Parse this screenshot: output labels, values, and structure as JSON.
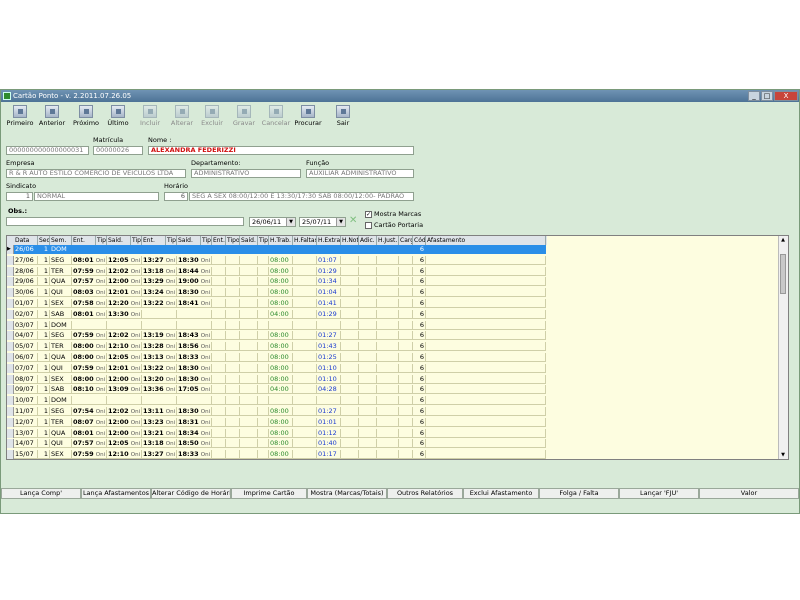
{
  "window": {
    "title": "Cartão Ponto - v. 2.2011.07.26.05",
    "minimize": "_",
    "maximize": "□",
    "close": "X"
  },
  "toolbar": [
    {
      "label": "Primeiro",
      "enabled": true
    },
    {
      "label": "Anterior",
      "enabled": true
    },
    {
      "label": "Próximo",
      "enabled": true
    },
    {
      "label": "Último",
      "enabled": true
    },
    {
      "label": "Incluir",
      "enabled": false
    },
    {
      "label": "Alterar",
      "enabled": false
    },
    {
      "label": "Excluir",
      "enabled": false
    },
    {
      "label": "Gravar",
      "enabled": false
    },
    {
      "label": "Cancelar",
      "enabled": false
    },
    {
      "label": "Procurar",
      "enabled": true
    },
    {
      "label": "Sair",
      "enabled": true
    }
  ],
  "form": {
    "matricula_label": "Matrícula",
    "nome_label": "Nome :",
    "code": "000000000000000031",
    "matricula": "00000026",
    "nome": "ALEXANDRA FEDERIZZI",
    "empresa_label": "Empresa",
    "empresa": "R & R AUTO ESTILO COMÉRCIO DE VEÍCULOS LTDA",
    "departamento_label": "Departamento:",
    "departamento": "ADMINISTRATIVO",
    "funcao_label": "Função",
    "funcao": "AUXILIAR ADMINISTRATIVO",
    "sindicato_label": "Sindicato",
    "sindicato_num": "1",
    "sindicato": "NORMAL",
    "horario_label": "Horário",
    "horario_num": "6",
    "horario": "SEG A SEX 08:00/12:00 E 13:30/17:30 SAB 08:00/12:00- PADRAO",
    "obs_label": "Obs.:",
    "date_from": "26/06/11",
    "date_to": "25/07/11",
    "mostra_marcas": "Mostra Marcas",
    "cartao_portaria": "Cartão Portaria"
  },
  "grid": {
    "headers": [
      "Data",
      "Seq.",
      "Sem.",
      "Ent.",
      "Tipo",
      "Saíd.",
      "Tipo",
      "Ent.",
      "Tipo",
      "Saíd.",
      "Tipo",
      "Ent.",
      "Tipo",
      "Saíd.",
      "Tipo",
      "H.Trab.",
      "H.Faltas",
      "H.Extras",
      "H.Not.",
      "Adic.",
      "H.Just.",
      "Carga",
      "Cód.",
      "Afastamento"
    ],
    "on_label": "Oni",
    "rows": [
      {
        "data": "26/06",
        "seq": "1",
        "sem": "DOM",
        "e1": "",
        "s1": "",
        "e2": "",
        "s2": "",
        "trab": "",
        "extra": "",
        "cod": "6",
        "selected": true
      },
      {
        "data": "27/06",
        "seq": "1",
        "sem": "SEG",
        "e1": "08:01",
        "s1": "12:05",
        "e2": "13:27",
        "s2": "18:30",
        "trab": "08:00",
        "extra": "01:07",
        "cod": "6"
      },
      {
        "data": "28/06",
        "seq": "1",
        "sem": "TER",
        "e1": "07:59",
        "s1": "12:02",
        "e2": "13:18",
        "s2": "18:44",
        "trab": "08:00",
        "extra": "01:29",
        "cod": "6"
      },
      {
        "data": "29/06",
        "seq": "1",
        "sem": "QUA",
        "e1": "07:57",
        "s1": "12:00",
        "e2": "13:29",
        "s2": "19:00",
        "trab": "08:00",
        "extra": "01:34",
        "cod": "6"
      },
      {
        "data": "30/06",
        "seq": "1",
        "sem": "QUI",
        "e1": "08:03",
        "s1": "12:01",
        "e2": "13:24",
        "s2": "18:30",
        "trab": "08:00",
        "extra": "01:04",
        "cod": "6"
      },
      {
        "data": "01/07",
        "seq": "1",
        "sem": "SEX",
        "e1": "07:58",
        "s1": "12:20",
        "e2": "13:22",
        "s2": "18:41",
        "trab": "08:00",
        "extra": "01:41",
        "cod": "6"
      },
      {
        "data": "02/07",
        "seq": "1",
        "sem": "SAB",
        "e1": "08:01",
        "s1": "13:30",
        "e2": "",
        "s2": "",
        "trab": "04:00",
        "extra": "01:29",
        "cod": "6"
      },
      {
        "data": "03/07",
        "seq": "1",
        "sem": "DOM",
        "e1": "",
        "s1": "",
        "e2": "",
        "s2": "",
        "trab": "",
        "extra": "",
        "cod": "6"
      },
      {
        "data": "04/07",
        "seq": "1",
        "sem": "SEG",
        "e1": "07:59",
        "s1": "12:02",
        "e2": "13:19",
        "s2": "18:43",
        "trab": "08:00",
        "extra": "01:27",
        "cod": "6"
      },
      {
        "data": "05/07",
        "seq": "1",
        "sem": "TER",
        "e1": "08:00",
        "s1": "12:10",
        "e2": "13:28",
        "s2": "18:56",
        "trab": "08:00",
        "extra": "01:43",
        "cod": "6"
      },
      {
        "data": "06/07",
        "seq": "1",
        "sem": "QUA",
        "e1": "08:00",
        "s1": "12:05",
        "e2": "13:13",
        "s2": "18:33",
        "trab": "08:00",
        "extra": "01:25",
        "cod": "6"
      },
      {
        "data": "07/07",
        "seq": "1",
        "sem": "QUI",
        "e1": "07:59",
        "s1": "12:01",
        "e2": "13:22",
        "s2": "18:30",
        "trab": "08:00",
        "extra": "01:10",
        "cod": "6"
      },
      {
        "data": "08/07",
        "seq": "1",
        "sem": "SEX",
        "e1": "08:00",
        "s1": "12:00",
        "e2": "13:20",
        "s2": "18:30",
        "trab": "08:00",
        "extra": "01:10",
        "cod": "6"
      },
      {
        "data": "09/07",
        "seq": "1",
        "sem": "SAB",
        "e1": "08:10",
        "s1": "13:09",
        "e2": "13:36",
        "s2": "17:05",
        "trab": "04:00",
        "extra": "04:28",
        "cod": "6"
      },
      {
        "data": "10/07",
        "seq": "1",
        "sem": "DOM",
        "e1": "",
        "s1": "",
        "e2": "",
        "s2": "",
        "trab": "",
        "extra": "",
        "cod": "6"
      },
      {
        "data": "11/07",
        "seq": "1",
        "sem": "SEG",
        "e1": "07:54",
        "s1": "12:02",
        "e2": "13:11",
        "s2": "18:30",
        "trab": "08:00",
        "extra": "01:27",
        "cod": "6"
      },
      {
        "data": "12/07",
        "seq": "1",
        "sem": "TER",
        "e1": "08:07",
        "s1": "12:00",
        "e2": "13:23",
        "s2": "18:31",
        "trab": "08:00",
        "extra": "01:01",
        "cod": "6"
      },
      {
        "data": "13/07",
        "seq": "1",
        "sem": "QUA",
        "e1": "08:01",
        "s1": "12:00",
        "e2": "13:21",
        "s2": "18:34",
        "trab": "08:00",
        "extra": "01:12",
        "cod": "6"
      },
      {
        "data": "14/07",
        "seq": "1",
        "sem": "QUI",
        "e1": "07:57",
        "s1": "12:05",
        "e2": "13:18",
        "s2": "18:50",
        "trab": "08:00",
        "extra": "01:40",
        "cod": "6"
      },
      {
        "data": "15/07",
        "seq": "1",
        "sem": "SEX",
        "e1": "07:59",
        "s1": "12:10",
        "e2": "13:27",
        "s2": "18:33",
        "trab": "08:00",
        "extra": "01:17",
        "cod": "6"
      }
    ]
  },
  "bottom_buttons": [
    "Lança Comp'",
    "Lança Afastamentos",
    "Alterar Código de Horário",
    "Imprime Cartão",
    "Mostra (Marcas/Totais)",
    "Outros Relatórios",
    "Exclui Afastamento",
    "Folga / Falta",
    "Lançar 'FJU'",
    "Valor"
  ]
}
